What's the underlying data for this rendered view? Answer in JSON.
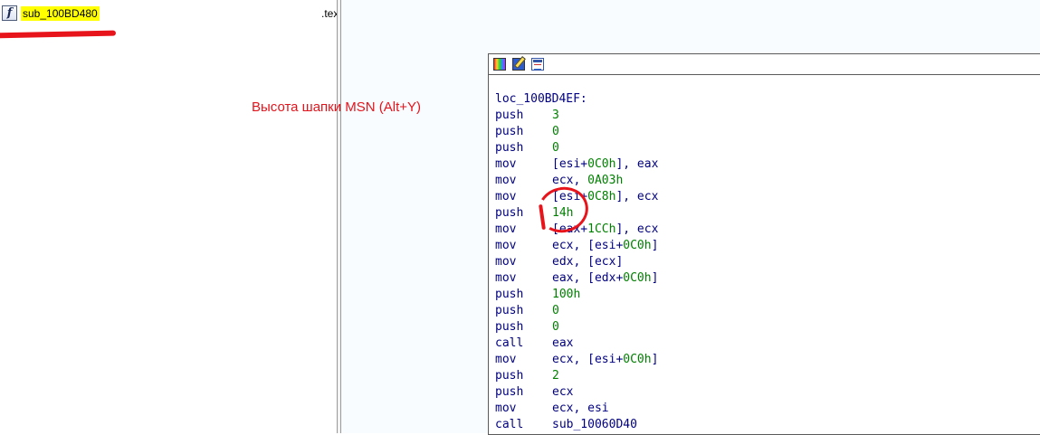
{
  "function_list": {
    "icon": "function-f-icon",
    "icon_glyph": "f",
    "function_name": "sub_100BD480",
    "segment": ".text"
  },
  "annotation": {
    "text": "Высота шапки MSN (Alt+Y)"
  },
  "graph_toolbar": {
    "buttons": [
      "color-palette-icon",
      "edit-pencil-icon",
      "graph-overview-icon"
    ]
  },
  "code_block": {
    "label": "loc_100BD4EF:",
    "lines": [
      {
        "mnem": "push",
        "ops": [
          {
            "t": "n",
            "v": "3"
          }
        ]
      },
      {
        "mnem": "push",
        "ops": [
          {
            "t": "n",
            "v": "0"
          }
        ]
      },
      {
        "mnem": "push",
        "ops": [
          {
            "t": "n",
            "v": "0"
          }
        ]
      },
      {
        "mnem": "mov",
        "ops": [
          {
            "t": "t",
            "v": "[esi+"
          },
          {
            "t": "n",
            "v": "0C0h"
          },
          {
            "t": "t",
            "v": "], eax"
          }
        ]
      },
      {
        "mnem": "mov",
        "ops": [
          {
            "t": "t",
            "v": "ecx, "
          },
          {
            "t": "n",
            "v": "0A03h"
          }
        ]
      },
      {
        "mnem": "mov",
        "ops": [
          {
            "t": "t",
            "v": "[esi+"
          },
          {
            "t": "n",
            "v": "0C8h"
          },
          {
            "t": "t",
            "v": "], ecx"
          }
        ]
      },
      {
        "mnem": "push",
        "ops": [
          {
            "t": "n",
            "v": "14h"
          }
        ]
      },
      {
        "mnem": "mov",
        "ops": [
          {
            "t": "t",
            "v": "[eax+"
          },
          {
            "t": "n",
            "v": "1CCh"
          },
          {
            "t": "t",
            "v": "], ecx"
          }
        ]
      },
      {
        "mnem": "mov",
        "ops": [
          {
            "t": "t",
            "v": "ecx, [esi+"
          },
          {
            "t": "n",
            "v": "0C0h"
          },
          {
            "t": "t",
            "v": "]"
          }
        ]
      },
      {
        "mnem": "mov",
        "ops": [
          {
            "t": "t",
            "v": "edx, [ecx]"
          }
        ]
      },
      {
        "mnem": "mov",
        "ops": [
          {
            "t": "t",
            "v": "eax, [edx+"
          },
          {
            "t": "n",
            "v": "0C0h"
          },
          {
            "t": "t",
            "v": "]"
          }
        ]
      },
      {
        "mnem": "push",
        "ops": [
          {
            "t": "n",
            "v": "100h"
          }
        ]
      },
      {
        "mnem": "push",
        "ops": [
          {
            "t": "n",
            "v": "0"
          }
        ]
      },
      {
        "mnem": "push",
        "ops": [
          {
            "t": "n",
            "v": "0"
          }
        ]
      },
      {
        "mnem": "call",
        "ops": [
          {
            "t": "t",
            "v": "eax"
          }
        ]
      },
      {
        "mnem": "mov",
        "ops": [
          {
            "t": "t",
            "v": "ecx, [esi+"
          },
          {
            "t": "n",
            "v": "0C0h"
          },
          {
            "t": "t",
            "v": "]"
          }
        ]
      },
      {
        "mnem": "push",
        "ops": [
          {
            "t": "n",
            "v": "2"
          }
        ]
      },
      {
        "mnem": "push",
        "ops": [
          {
            "t": "t",
            "v": "ecx"
          }
        ]
      },
      {
        "mnem": "mov",
        "ops": [
          {
            "t": "t",
            "v": "ecx, esi"
          }
        ]
      },
      {
        "mnem": "call",
        "ops": [
          {
            "t": "t",
            "v": "sub_10060D40"
          }
        ]
      }
    ]
  },
  "colors": {
    "code_text": "#000080",
    "code_number": "#008000",
    "highlight": "#ffff00",
    "annotation_red": "#e3141c"
  }
}
